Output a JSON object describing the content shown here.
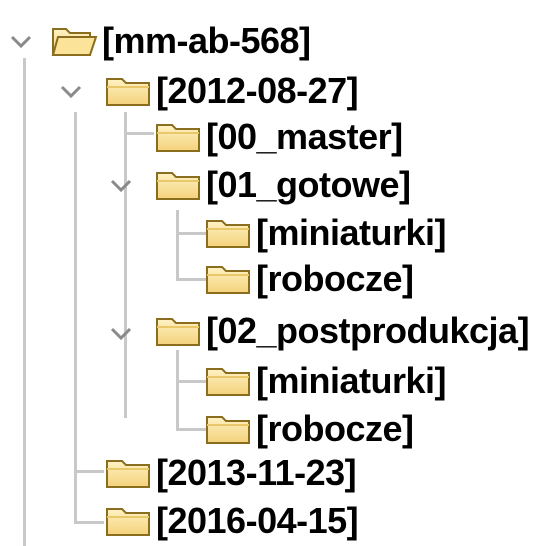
{
  "tree": {
    "root": {
      "label": "[mm-ab-568]",
      "expanded": true,
      "icon": "folder-open-icon"
    },
    "date_2012": {
      "label": "[2012-08-27]",
      "expanded": true,
      "icon": "folder-icon"
    },
    "master": {
      "label": "[00_master]",
      "icon": "folder-icon"
    },
    "gotowe": {
      "label": "[01_gotowe]",
      "expanded": true,
      "icon": "folder-icon"
    },
    "gotowe_miniaturki": {
      "label": "[miniaturki]",
      "icon": "folder-icon"
    },
    "gotowe_robocze": {
      "label": "[robocze]",
      "icon": "folder-icon"
    },
    "postprodukcja": {
      "label": "[02_postprodukcja]",
      "expanded": true,
      "icon": "folder-icon"
    },
    "post_miniaturki": {
      "label": "[miniaturki]",
      "icon": "folder-icon"
    },
    "post_robocze": {
      "label": "[robocze]",
      "icon": "folder-icon"
    },
    "date_2013": {
      "label": "[2013-11-23]",
      "icon": "folder-icon"
    },
    "date_2016": {
      "label": "[2016-04-15]",
      "icon": "folder-icon"
    }
  },
  "colors": {
    "folder_fill": "#fbe49a",
    "folder_stroke": "#8a6d1e",
    "guide_line": "#c8c8c8",
    "chevron": "#8a8a8a"
  }
}
